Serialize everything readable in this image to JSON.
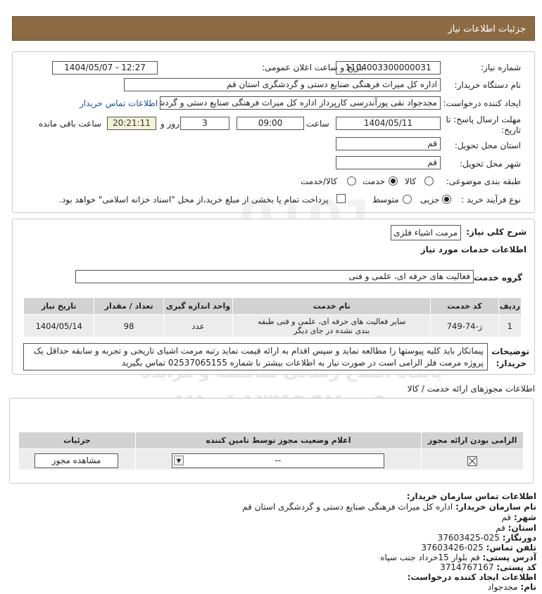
{
  "header": {
    "title": "جزئیات اطلاعات نیاز"
  },
  "form": {
    "need_number_label": "شماره نیاز:",
    "need_number": "1104003300000031",
    "announce_label": "تاریخ و ساعت اعلان عمومی:",
    "announce_value": "1404/05/07 - 12:27",
    "buyer_org_label": "نام دستگاه خریدار:",
    "buyer_org": "اداره کل میراث فرهنگی  صنایع دستی و گردشگری استان قم",
    "requester_label": "ایجاد کننده درخواست:",
    "requester": "مجدجواد نقی پورآندرسی کارپرداز اداره کل میراث فرهنگی  صنایع دستی و گردشگری استان قم",
    "contact_link": "اطلاعات تماس خریدار",
    "deadline_label_1": "مهلت ارسال پاسخ: تا",
    "deadline_label_2": "تاریخ:",
    "deadline_date": "1404/05/11",
    "time_label": "ساعت",
    "deadline_time": "09:00",
    "days_value": "3",
    "days_label": "روز و",
    "remaining_time": "20:21:11",
    "remaining_label": "ساعت باقی مانده",
    "province_label": "استان محل تحویل:",
    "province": "قم",
    "city_label": "شهر محل تحویل:",
    "city": "قم",
    "category_label": "طبقه بندی موضوعی:",
    "category_options": [
      "کالا",
      "خدمت",
      "کالا/خدمت"
    ],
    "category_selected": "خدمت",
    "process_label": "نوع فرآیند خرید :",
    "process_options": [
      "جزیی",
      "متوسط"
    ],
    "process_selected": "جزیی",
    "payment_note": "پرداخت تمام یا بخشی از مبلغ خرید،از محل \"اسناد خزانه اسلامی\" خواهد بود."
  },
  "summary": {
    "desc_label": "شرح کلی نیاز:",
    "desc_value": "مرمت اشیاء فلزی",
    "services_title": "اطلاعات خدمات مورد نیاز",
    "service_group_label": "گروه خدمت:",
    "service_group": "فعالیت های حرفه ای، علمی و فنی",
    "table": {
      "headers": [
        "ردیف",
        "کد خدمت",
        "نام خدمت",
        "واحد اندازه گیری",
        "تعداد / مقدار",
        "تاریخ نیاز"
      ],
      "rows": [
        [
          "1",
          "ز-74-749",
          "سایر فعالیت های حرفه ای، علمی و فنی طبقه بندی نشده در جای دیگر",
          "عدد",
          "98",
          "1404/05/14"
        ]
      ]
    },
    "buyer_notes_label_1": "توضیحات",
    "buyer_notes_label_2": "خریدار:",
    "buyer_notes": "پیمانکار باید کلیه پیوستها را مطالعه نماید و سپس اقدام به ارائه قیمت نماید رتبه مرمت اشیای تاریخی و تجربه و سابقه حداقل یک پروژه مرمت فلز الزامی است در صورت نیاز به اطلاعات بیشتر با شماره 02537065155 تماس بگیرید"
  },
  "permits": {
    "section_title": "اطلاعات مجوزهای ارائه خدمت / کالا",
    "headers": [
      "الزامی بودن ارائه مجوز",
      "اعلام وضعیت مجوز توسط تامین کننده",
      "جزئیات"
    ],
    "select_value": "--",
    "view_button": "مشاهده مجوز"
  },
  "contact": {
    "title": "اطلاعات تماس سازمان خریدار:",
    "org_label": "نام سازمان خریدار:",
    "org_value": "اداره کل میراث فرهنگی صنایع دستی و گردشگری استان قم",
    "city_label": "شهر:",
    "city_value": "قم",
    "province_label": "استان:",
    "province_value": "قم",
    "fax_label": "دورنگار:",
    "fax_value": "025-37603425",
    "phone_label": "تلفن تماس:",
    "phone_value": "025-37603426",
    "address_label": "آدرس پستی:",
    "address_value": "قم بلوار 15خرداد جنب سپاه",
    "postal_label": "کد پستی:",
    "postal_value": "3714767167",
    "creator_title": "اطلاعات ایجاد کننده درخواست:",
    "name_label": "نام:",
    "name_value": "مجدجواد"
  },
  "watermark": {
    "line1": "ParsNamadData",
    "line2": "پایگاه اطلاع رسانی مناقصه و مزایده",
    "phone": "۰۲۱-۸۸۳۴۹۶۷۰-۵"
  },
  "colors": {
    "header_bg": "#8c6a43",
    "link": "#1a4ea8",
    "table_head": "#d2d2d2",
    "table_cell": "#ececec"
  }
}
